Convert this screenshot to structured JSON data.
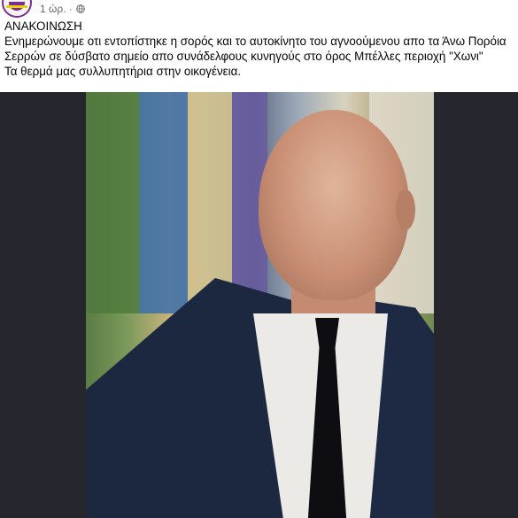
{
  "post": {
    "time": "1 ώρ. ·",
    "privacy_icon": "globe-icon",
    "lines": [
      "ΑΝΑΚΟΙΝΩΣΗ",
      "Ενημερώνουμε οτι εντοπίστηκε η σορός και το αυτοκίνητο του αγνοούμενου απο τα Άνω Πορόια",
      "Σερρών σε δύσβατο σημείο απο συνάδελφους κυνηγούς στο όρος Μπέλλες περιοχή \"Χωνι\"",
      "Τα θερμά μας συλλυπητήρια στην οικογένεια."
    ]
  },
  "colors": {
    "accent": "#7b2f8f",
    "meta_text": "#65676b",
    "media_background": "#26262e"
  }
}
